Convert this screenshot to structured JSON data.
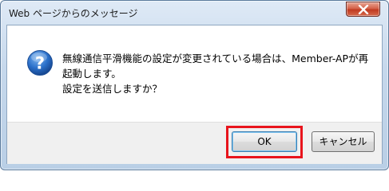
{
  "dialog": {
    "title": "Web ページからのメッセージ",
    "icon": "question-icon",
    "message_lines": [
      "無線通信平滑機能の設定が変更されている場合は、Member-APが再",
      "起動します。",
      "設定を送信しますか？"
    ],
    "buttons": {
      "ok_label": "OK",
      "cancel_label": "キャンセル"
    },
    "highlight_color": "#e8141c"
  }
}
